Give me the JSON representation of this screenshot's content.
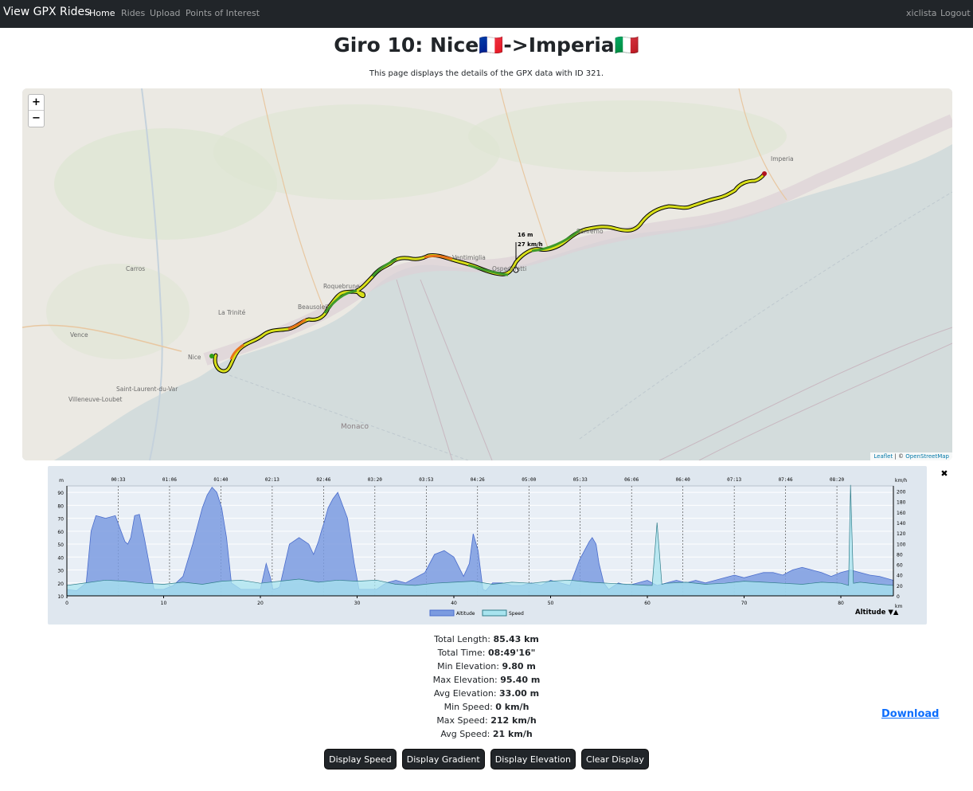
{
  "nav": {
    "brand": "View GPX Rides",
    "links": [
      "Home",
      "Rides",
      "Upload",
      "Points of Interest"
    ],
    "user": "xiclista",
    "logout": "Logout"
  },
  "page": {
    "title": "Giro 10: Nice🇫🇷->Imperia🇮🇹",
    "subtitle": "This page displays the details of the GPX data with ID 321."
  },
  "map": {
    "zoom_in": "+",
    "zoom_out": "−",
    "attribution_leaflet": "Leaflet",
    "attribution_sep": " | © ",
    "attribution_osm": "OpenStreetMap",
    "tooltip_elev": "16 m",
    "tooltip_speed": "27 km/h",
    "labels": [
      "Nice",
      "Monaco",
      "Imperia",
      "Carros",
      "Vence",
      "La Trinité",
      "Beausoleil",
      "Roquebrune",
      "Saint-Laurent-du-Var",
      "Villeneuve-Loubet",
      "Sanremo",
      "Ospedaletti",
      "Ventimiglia"
    ],
    "track_colors": [
      "#2e7d20",
      "#7fbf1a",
      "#f2e400",
      "#f29b16",
      "#e84a16"
    ]
  },
  "chart": {
    "close": "✖",
    "unit_left": "m",
    "unit_right": "km/h",
    "unit_x": "km",
    "time_ticks": [
      "00:33",
      "01:06",
      "01:40",
      "02:13",
      "02:46",
      "03:20",
      "03:53",
      "04:26",
      "05:00",
      "05:33",
      "06:06",
      "06:40",
      "07:13",
      "07:46",
      "08:20"
    ],
    "y_left_ticks": [
      "90",
      "80",
      "70",
      "60",
      "50",
      "40",
      "30",
      "20",
      "10"
    ],
    "y_right_ticks": [
      "200",
      "180",
      "160",
      "140",
      "120",
      "100",
      "80",
      "60",
      "40",
      "20",
      "0"
    ],
    "x_ticks": [
      "0",
      "10",
      "20",
      "30",
      "40",
      "50",
      "60",
      "70",
      "80"
    ],
    "legend_altitude": "Altitude",
    "legend_speed": "Speed",
    "selector": "Altitude ▼▲",
    "altitude_color": "#7b9be0",
    "speed_color": "#a8e4ef"
  },
  "chart_data": {
    "type": "area",
    "xlabel": "km",
    "ylabel": "m",
    "xlim": [
      0,
      85.43
    ],
    "ylim": [
      10,
      95
    ],
    "y2lim": [
      0,
      210
    ],
    "series": [
      {
        "name": "Altitude",
        "x": [
          0,
          1,
          2,
          2.5,
          3,
          4,
          5,
          5.5,
          6,
          6.3,
          6.6,
          7,
          7.5,
          8,
          9,
          10,
          11,
          12,
          13,
          14,
          14.5,
          15,
          15.5,
          16,
          16.5,
          17,
          18,
          19,
          20,
          20.6,
          21,
          21.3,
          21.8,
          22,
          23,
          24,
          25,
          25.5,
          26,
          26.3,
          26.6,
          27,
          27.5,
          28,
          29,
          29.7,
          30.2,
          31,
          32,
          33,
          34,
          35,
          36,
          37,
          38,
          39,
          40,
          41,
          41.6,
          42,
          42.5,
          43,
          43.3,
          44,
          45,
          46,
          47,
          48,
          49,
          50,
          51,
          52,
          53,
          54,
          54.3,
          54.7,
          55,
          55.5,
          56,
          57,
          58,
          59,
          60,
          61,
          62,
          63,
          64,
          65,
          66,
          67,
          68,
          69,
          70,
          71,
          72,
          73,
          74,
          75,
          76,
          77,
          78,
          79,
          80,
          81,
          82,
          83,
          84,
          85.43
        ],
        "y": [
          15,
          14,
          20,
          60,
          72,
          70,
          72,
          62,
          52,
          50,
          55,
          72,
          73,
          55,
          15,
          15,
          18,
          25,
          50,
          78,
          88,
          94,
          90,
          78,
          55,
          20,
          15,
          15,
          15,
          35,
          25,
          15,
          16,
          17,
          50,
          55,
          50,
          42,
          52,
          60,
          67,
          78,
          85,
          90,
          70,
          35,
          15,
          15,
          15,
          20,
          22,
          20,
          24,
          28,
          42,
          45,
          40,
          25,
          35,
          58,
          45,
          15,
          14,
          20,
          20,
          18,
          18,
          20,
          18,
          22,
          20,
          18,
          38,
          52,
          55,
          50,
          35,
          20,
          15,
          20,
          18,
          20,
          22,
          18,
          20,
          22,
          20,
          22,
          20,
          22,
          24,
          26,
          24,
          26,
          28,
          28,
          26,
          30,
          32,
          30,
          28,
          25,
          28,
          30,
          28,
          26,
          25,
          22
        ]
      },
      {
        "name": "Speed",
        "x": [
          0,
          2,
          4,
          6,
          8,
          10,
          12,
          14,
          16,
          18,
          20,
          22,
          24,
          26,
          28,
          30,
          32,
          34,
          36,
          38,
          40,
          42,
          44,
          46,
          48,
          50,
          52,
          54,
          56,
          58,
          60,
          60.5,
          61,
          61.5,
          62,
          64,
          66,
          68,
          70,
          72,
          74,
          76,
          78,
          80,
          80.8,
          81,
          81.3,
          82,
          84,
          85.43
        ],
        "y": [
          20,
          25,
          30,
          28,
          24,
          22,
          26,
          22,
          28,
          30,
          24,
          28,
          32,
          26,
          30,
          28,
          30,
          22,
          20,
          24,
          26,
          28,
          22,
          26,
          24,
          28,
          30,
          26,
          24,
          22,
          20,
          20,
          140,
          22,
          24,
          26,
          22,
          24,
          28,
          26,
          24,
          22,
          26,
          24,
          20,
          212,
          24,
          26,
          22,
          20
        ]
      }
    ]
  },
  "stats": [
    {
      "label": "Total Length:",
      "value": "85.43 km"
    },
    {
      "label": "Total Time:",
      "value": "08:49'16\""
    },
    {
      "label": "Min Elevation:",
      "value": "9.80 m"
    },
    {
      "label": "Max Elevation:",
      "value": "95.40 m"
    },
    {
      "label": "Avg Elevation:",
      "value": "33.00 m"
    },
    {
      "label": "Min Speed:",
      "value": "0 km/h"
    },
    {
      "label": "Max Speed:",
      "value": "212 km/h"
    },
    {
      "label": "Avg Speed:",
      "value": "21 km/h"
    }
  ],
  "download": "Download",
  "buttons": [
    "Display Speed",
    "Display Gradient",
    "Display Elevation",
    "Clear Display"
  ]
}
